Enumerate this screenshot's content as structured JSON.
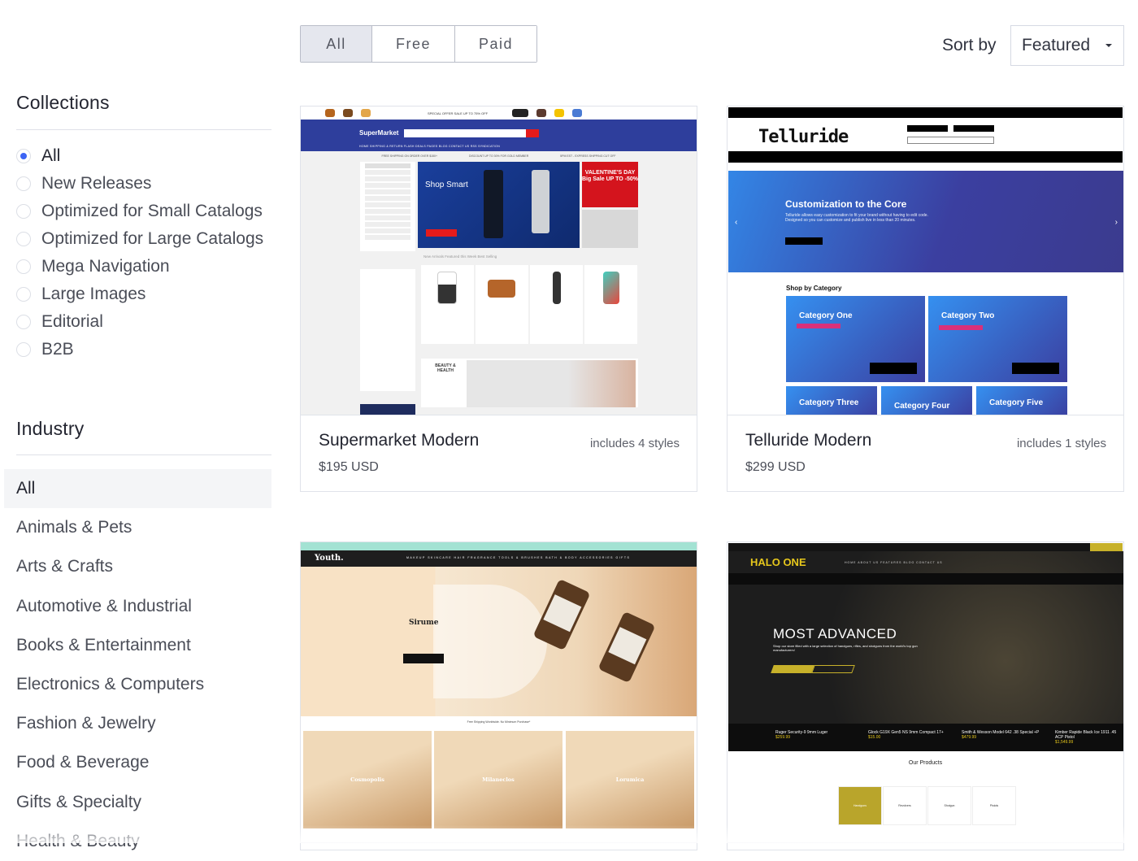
{
  "filters": {
    "price_tabs": [
      {
        "label": "All",
        "active": true
      },
      {
        "label": "Free",
        "active": false
      },
      {
        "label": "Paid",
        "active": false
      }
    ],
    "sort": {
      "label": "Sort by",
      "selected": "Featured"
    }
  },
  "sidebar": {
    "collections": {
      "title": "Collections",
      "items": [
        {
          "label": "All",
          "checked": true
        },
        {
          "label": "New Releases",
          "checked": false
        },
        {
          "label": "Optimized for Small Catalogs",
          "checked": false
        },
        {
          "label": "Optimized for Large Catalogs",
          "checked": false
        },
        {
          "label": "Mega Navigation",
          "checked": false
        },
        {
          "label": "Large Images",
          "checked": false
        },
        {
          "label": "Editorial",
          "checked": false
        },
        {
          "label": "B2B",
          "checked": false
        }
      ]
    },
    "industry": {
      "title": "Industry",
      "items": [
        {
          "label": "All",
          "active": true
        },
        {
          "label": "Animals & Pets"
        },
        {
          "label": "Arts & Crafts"
        },
        {
          "label": "Automotive & Industrial"
        },
        {
          "label": "Books & Entertainment"
        },
        {
          "label": "Electronics & Computers"
        },
        {
          "label": "Fashion & Jewelry"
        },
        {
          "label": "Food & Beverage"
        },
        {
          "label": "Gifts & Specialty"
        },
        {
          "label": "Health & Beauty"
        }
      ]
    }
  },
  "themes": [
    {
      "name": "Supermarket Modern",
      "price": "$195 USD",
      "styles": "includes 4 styles",
      "preview": {
        "logo": "SuperMarket",
        "promo": "SPECIAL OFFER SALE UP TO 75% OFF",
        "nav": "HOME   SHIPPING & RETURN   FLASH DEALS   PAGES   BLOG   CONTACT US   RSS SYNDICATION",
        "hero_title": "Shop Smart",
        "valentine": "VALENTINE'S DAY Big Sale UP TO -50%",
        "tabs": "New Arrivals    Featured this Week    Best Selling",
        "beauty": "BEAUTY & HEALTH"
      }
    },
    {
      "name": "Telluride Modern",
      "price": "$299 USD",
      "styles": "includes 1 styles",
      "preview": {
        "logo": "Telluride",
        "hero_title": "Customization to the Core",
        "hero_text": "Telluride allows easy customization to fit your brand without having to edit code. Designed so you can customize and publish live in less than 20 minutes.",
        "section_title": "Shop by Category",
        "categories": [
          "Category One",
          "Category Two",
          "Category Three",
          "Category Four",
          "Category Five"
        ]
      }
    },
    {
      "name": "Youth",
      "price": "",
      "styles": "",
      "preview": {
        "logo": "Youth.",
        "menu": "MAKEUP  SKINCARE  HAIR  FRAGRANCE  TOOLS & BRUSHES  BATH & BODY  ACCESSORIES  GIFTS",
        "hero_title": "Sirume",
        "free_shipping": "Free Shipping Worldwide. No Minimum Purchase*",
        "tiles": [
          "Cosmopolis",
          "Milaneclos",
          "Lorumica"
        ]
      }
    },
    {
      "name": "Halo One",
      "price": "",
      "styles": "",
      "preview": {
        "logo": "HALO ONE",
        "menu": "HOME   ABOUT US   FEATURES   BLOG   CONTACT US",
        "hero_title": "MOST ADVANCED",
        "hero_text": "Shop our store filled with a large selection of handguns, rifles, and shotguns from the world's top gun manufacturers!",
        "products": [
          {
            "name": "Ruger Security-9 9mm Luger",
            "price": "$259.99"
          },
          {
            "name": "Glock G19X Gen5 NS 9mm Compact 17+",
            "price": "$15.00"
          },
          {
            "name": "Smith & Wesson Model 642 .38 Special +P",
            "price": "$479.99"
          },
          {
            "name": "Kimber Rapide Black Ice 1911 .45 ACP Pistol",
            "price": "$1,549.99"
          }
        ],
        "section_title": "Our Products",
        "tiles": [
          "Handguns",
          "Revolvers",
          "Shotgun",
          "Pistols"
        ]
      }
    }
  ]
}
